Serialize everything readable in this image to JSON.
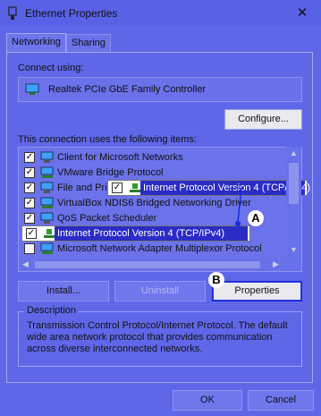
{
  "window": {
    "title": "Ethernet Properties",
    "close_glyph": "✕"
  },
  "tabs": [
    {
      "label": "Networking",
      "active": true
    },
    {
      "label": "Sharing",
      "active": false
    }
  ],
  "connect_using": {
    "label": "Connect using:",
    "adapter": "Realtek PCIe GbE Family Controller",
    "adapter_icon": "network-adapter-icon",
    "configure_label": "Configure..."
  },
  "items_section": {
    "label": "This connection uses the following items:",
    "items": [
      {
        "label": "Client for Microsoft Networks",
        "checked": true,
        "icon": "client-icon"
      },
      {
        "label": "VMware Bridge Protocol",
        "checked": true,
        "icon": "protocol-icon"
      },
      {
        "label": "File and Print",
        "checked": true,
        "icon": "service-icon"
      },
      {
        "label": "VirtualBox NDIS6 Bridged Networking Driver",
        "checked": true,
        "icon": "protocol-icon"
      },
      {
        "label": "QoS Packet Scheduler",
        "checked": true,
        "icon": "service-icon"
      },
      {
        "label": "Internet Protocol Version 4 (TCP/IPv4)",
        "checked": true,
        "icon": "protocol-icon",
        "selected": true
      },
      {
        "label": "Microsoft Network Adapter Multiplexor Protocol",
        "checked": false,
        "icon": "protocol-icon"
      }
    ],
    "popup_label": "Internet Protocol Version 4 (TCP/IPv4)"
  },
  "annotations": {
    "a": "A",
    "b": "B"
  },
  "buttons": {
    "install": "Install...",
    "uninstall": "Uninstall",
    "properties": "Properties",
    "ok": "OK",
    "cancel": "Cancel"
  },
  "description": {
    "title": "Description",
    "text": "Transmission Control Protocol/Internet Protocol. The default wide area network protocol that provides communication across diverse interconnected networks."
  },
  "colors": {
    "background": "#5f67e8",
    "selection": "#2b2bc5",
    "accent_line": "#1a2bd8"
  }
}
